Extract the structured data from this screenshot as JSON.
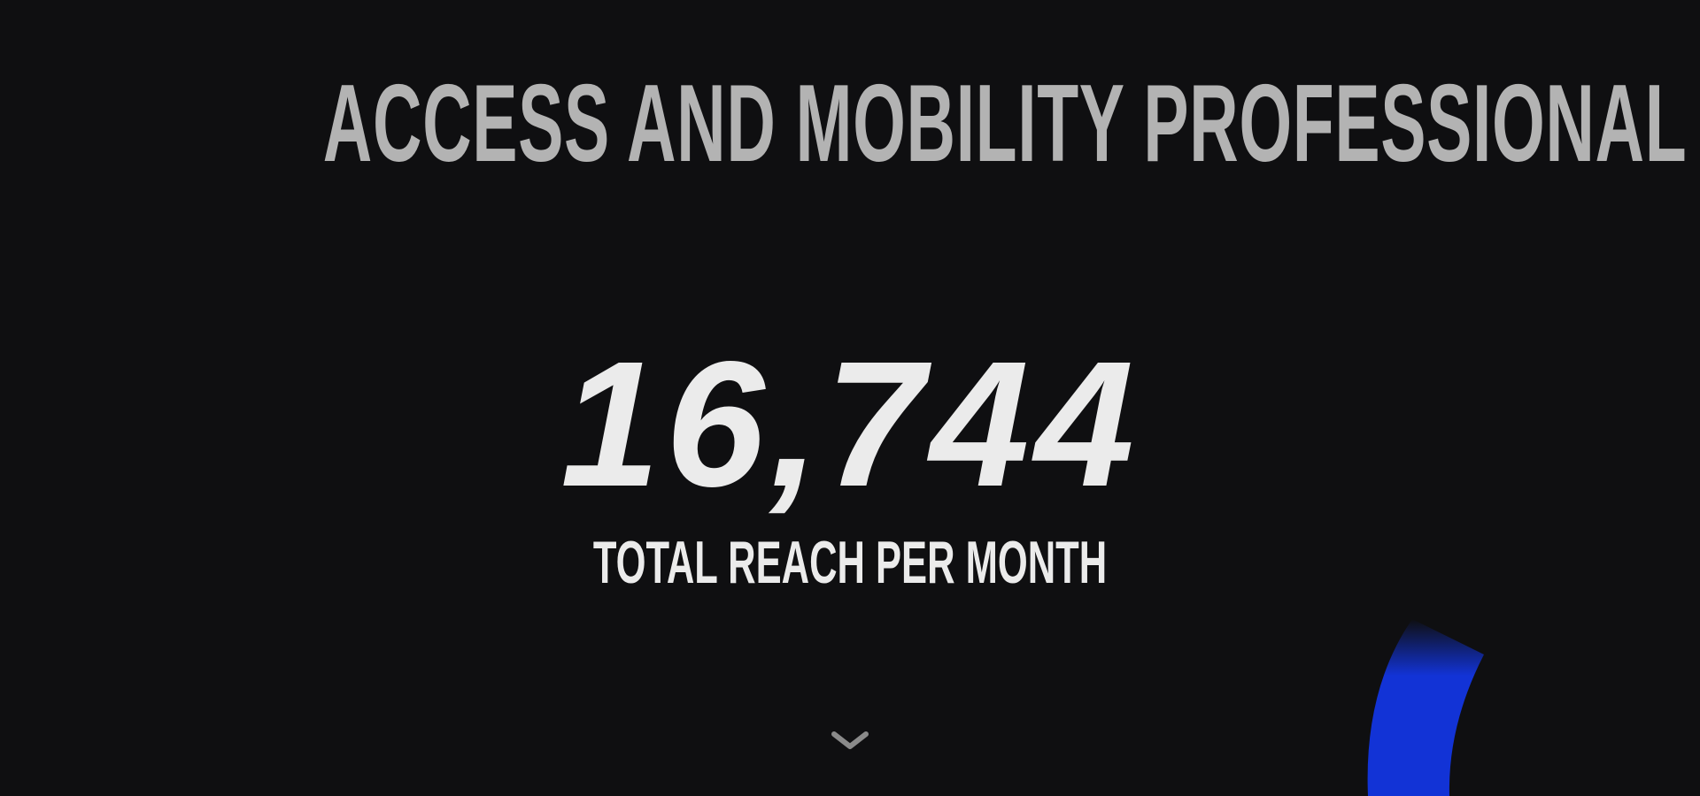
{
  "hero": {
    "title": "ACCESS AND MOBILITY PROFESSIONAL",
    "stat_value": "16,744",
    "stat_label": "TOTAL REACH PER MONTH"
  },
  "scroll_indicator": {
    "icon": "chevron-down-icon"
  },
  "colors": {
    "background": "#0f0f11",
    "title": "#b3b3b3",
    "stat": "#ebebeb",
    "accent_arc": "#1233d6",
    "chevron": "#8a8a8a"
  }
}
